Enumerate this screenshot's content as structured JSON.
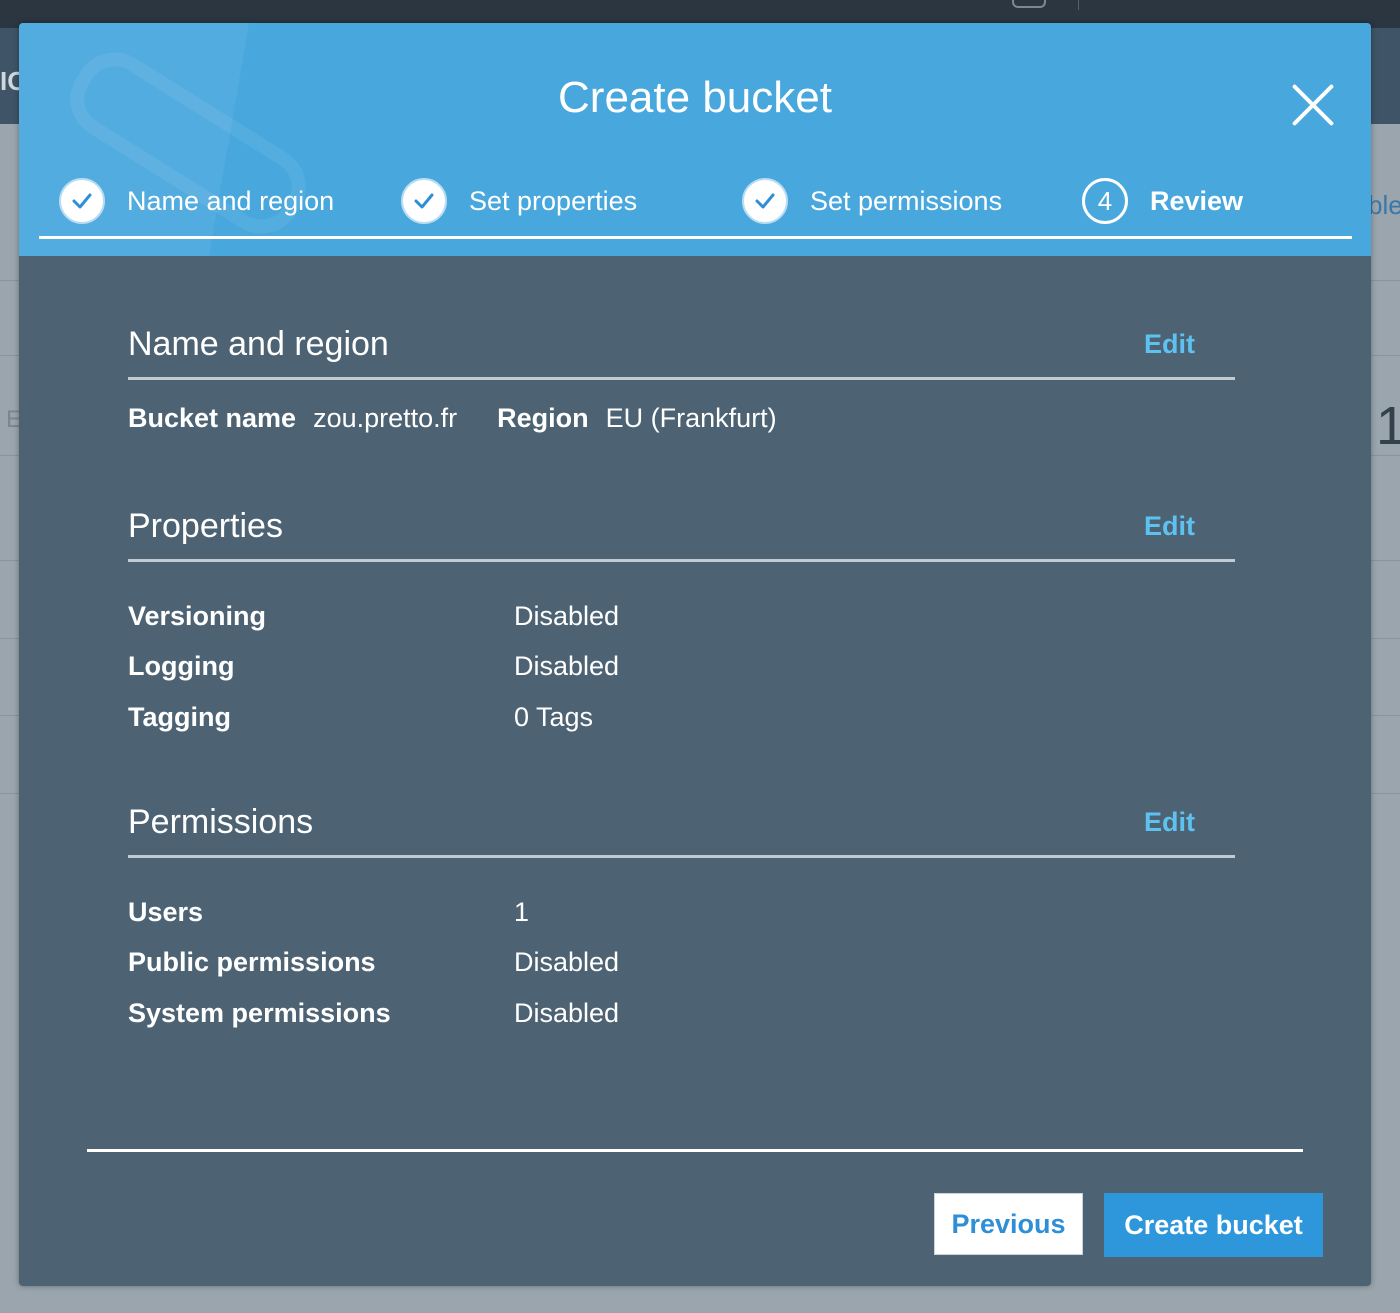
{
  "modal": {
    "title": "Create bucket",
    "steps": [
      {
        "label": "Name and region",
        "state": "complete"
      },
      {
        "label": "Set properties",
        "state": "complete"
      },
      {
        "label": "Set permissions",
        "state": "complete"
      },
      {
        "label": "Review",
        "state": "active",
        "number": "4"
      }
    ]
  },
  "name_region": {
    "title": "Name and region",
    "edit_label": "Edit",
    "bucket_name_key": "Bucket name",
    "bucket_name_value": "zou.pretto.fr",
    "region_key": "Region",
    "region_value": "EU (Frankfurt)"
  },
  "properties": {
    "title": "Properties",
    "edit_label": "Edit",
    "rows": [
      {
        "label": "Versioning",
        "value": "Disabled"
      },
      {
        "label": "Logging",
        "value": "Disabled"
      },
      {
        "label": "Tagging",
        "value": "0 Tags"
      }
    ]
  },
  "permissions": {
    "title": "Permissions",
    "edit_label": "Edit",
    "rows": [
      {
        "label": "Users",
        "value": "1"
      },
      {
        "label": "Public permissions",
        "value": "Disabled"
      },
      {
        "label": "System permissions",
        "value": "Disabled"
      }
    ]
  },
  "footer": {
    "previous_label": "Previous",
    "create_label": "Create bucket"
  },
  "background": {
    "nav_fragment": "IC",
    "side_fragment": "ble",
    "digit_fragment": "1",
    "letter_fragment": "E"
  },
  "colors": {
    "header_blue": "#48a7dd",
    "body_slate": "#4d6373",
    "link_blue": "#5ec2f1",
    "primary_button": "#2e96db"
  }
}
